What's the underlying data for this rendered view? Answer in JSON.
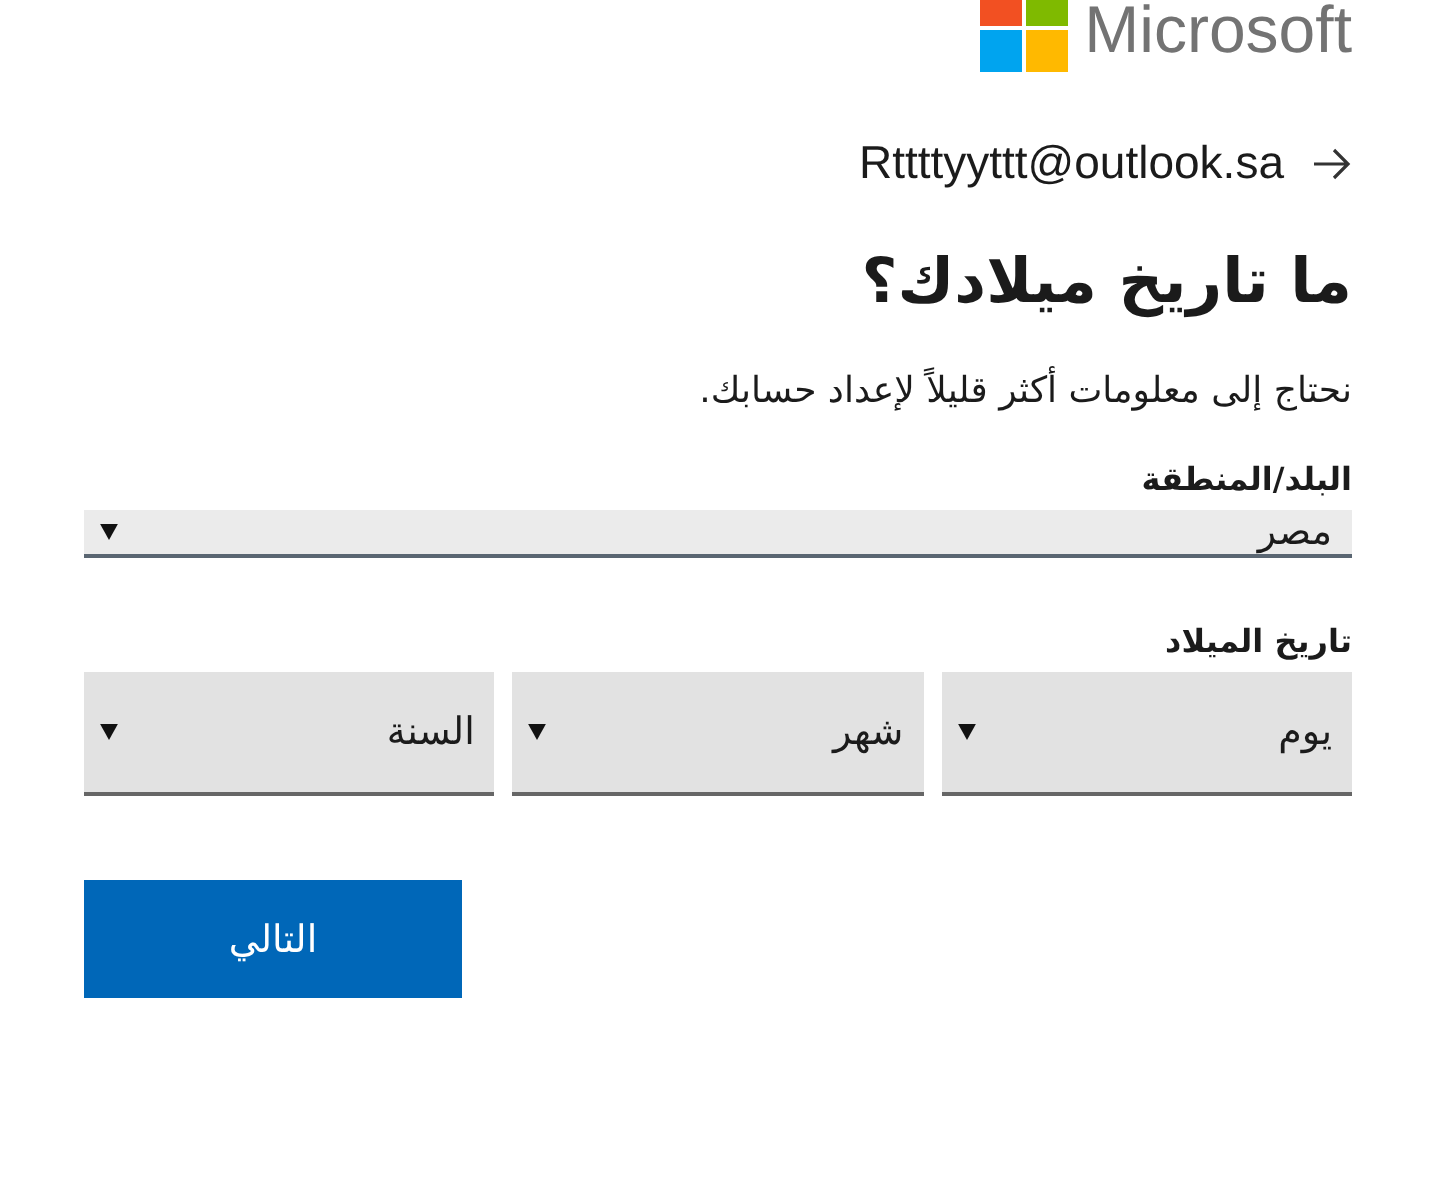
{
  "logo": {
    "text": "Microsoft"
  },
  "account": {
    "email": "Rttttyyttt@outlook.sa"
  },
  "heading": "ما تاريخ ميلادك؟",
  "description": "نحتاج إلى معلومات أكثر قليلاً لإعداد حسابك.",
  "country": {
    "label": "البلد/المنطقة",
    "value": "مصر"
  },
  "birthdate": {
    "label": "تاريخ الميلاد",
    "selects": [
      {
        "value": "يوم"
      },
      {
        "value": "شهر"
      },
      {
        "value": "السنة"
      }
    ]
  },
  "buttons": [
    {
      "label": "التالي",
      "kind": "primary"
    }
  ]
}
